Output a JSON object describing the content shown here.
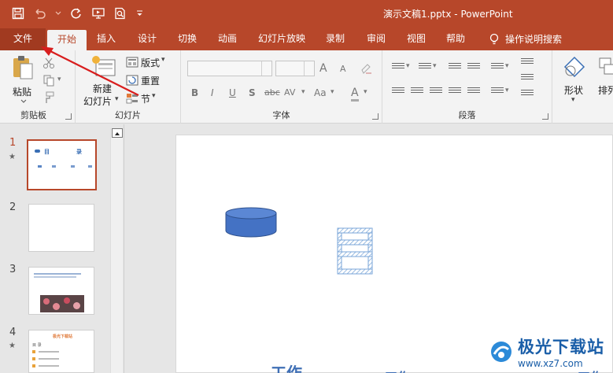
{
  "app": {
    "title": "演示文稿1.pptx  -  PowerPoint",
    "accent": "#b7472a"
  },
  "quick_access": {
    "save_icon": "save-icon",
    "undo_icon": "undo-icon",
    "redo_icon": "redo-icon",
    "presenter_icon": "slideshow-icon",
    "print_preview_icon": "print-preview-icon",
    "customize_icon": "customize-dropdown-icon"
  },
  "tabs": {
    "file": "文件",
    "home": "开始",
    "insert": "插入",
    "design": "设计",
    "transitions": "切换",
    "animations": "动画",
    "slideshow": "幻灯片放映",
    "record": "录制",
    "review": "审阅",
    "view": "视图",
    "help": "帮助",
    "tell_me": "操作说明搜索"
  },
  "ribbon": {
    "clipboard": {
      "paste": "粘贴",
      "label": "剪贴板"
    },
    "slides": {
      "new_slide_line1": "新建",
      "new_slide_line2": "幻灯片",
      "layout": "版式",
      "reset": "重置",
      "section": "节",
      "label": "幻灯片"
    },
    "font": {
      "bold": "B",
      "italic": "I",
      "underline": "U",
      "shadow": "S",
      "strike": "abc",
      "spacing": "AV",
      "case": "Aa",
      "color": "A",
      "grow": "A",
      "shrink": "A",
      "label": "字体"
    },
    "paragraph": {
      "label": "段落"
    },
    "drawing": {
      "shapes": "形状",
      "arrange": "排列"
    }
  },
  "slides": [
    {
      "number": "1",
      "starred": "★",
      "selected": true,
      "title_left": "目",
      "title_right": "录"
    },
    {
      "number": "2",
      "starred": "",
      "selected": false
    },
    {
      "number": "3",
      "starred": "",
      "selected": false
    },
    {
      "number": "4",
      "starred": "★",
      "selected": false,
      "heading": "极光下载站",
      "list_a": "目 录"
    }
  ],
  "slide_canvas": {
    "bottom_text_left": "工作",
    "bottom_text_mid": "工作",
    "bottom_text_right": "工作"
  },
  "watermark": {
    "text": "极光下载站",
    "url": "www.xz7.com"
  }
}
